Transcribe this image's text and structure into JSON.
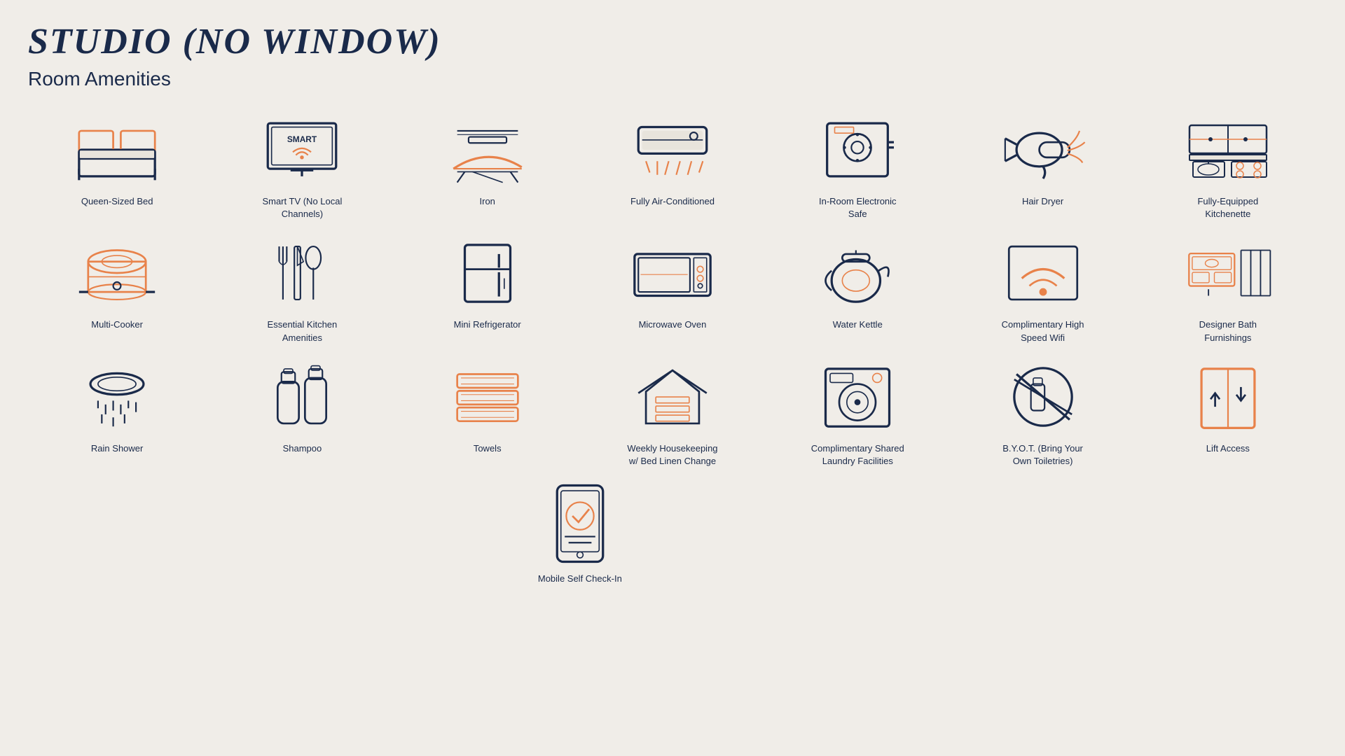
{
  "page": {
    "title": "STUDIO (NO WINDOW)",
    "subtitle": "Room Amenities"
  },
  "amenities": [
    {
      "id": "queen-bed",
      "label": "Queen-Sized Bed"
    },
    {
      "id": "smart-tv",
      "label": "Smart TV (No Local Channels)"
    },
    {
      "id": "iron",
      "label": "Iron"
    },
    {
      "id": "air-conditioned",
      "label": "Fully Air-Conditioned"
    },
    {
      "id": "electronic-safe",
      "label": "In-Room Electronic Safe"
    },
    {
      "id": "hair-dryer",
      "label": "Hair Dryer"
    },
    {
      "id": "kitchenette",
      "label": "Fully-Equipped Kitchenette"
    },
    {
      "id": "multi-cooker",
      "label": "Multi-Cooker"
    },
    {
      "id": "kitchen-amenities",
      "label": "Essential Kitchen Amenities"
    },
    {
      "id": "mini-fridge",
      "label": "Mini Refrigerator"
    },
    {
      "id": "microwave",
      "label": "Microwave Oven"
    },
    {
      "id": "water-kettle",
      "label": "Water Kettle"
    },
    {
      "id": "wifi",
      "label": "Complimentary High Speed Wifi"
    },
    {
      "id": "bath-furnishings",
      "label": "Designer Bath Furnishings"
    },
    {
      "id": "rain-shower",
      "label": "Rain Shower"
    },
    {
      "id": "shampoo",
      "label": "Shampoo"
    },
    {
      "id": "towels",
      "label": "Towels"
    },
    {
      "id": "housekeeping",
      "label": "Weekly Housekeeping w/ Bed Linen Change"
    },
    {
      "id": "laundry",
      "label": "Complimentary Shared Laundry Facilities"
    },
    {
      "id": "byot",
      "label": "B.Y.O.T. (Bring Your Own Toiletries)"
    },
    {
      "id": "lift",
      "label": "Lift Access"
    },
    {
      "id": "mobile-checkin",
      "label": "Mobile Self Check-In"
    }
  ]
}
